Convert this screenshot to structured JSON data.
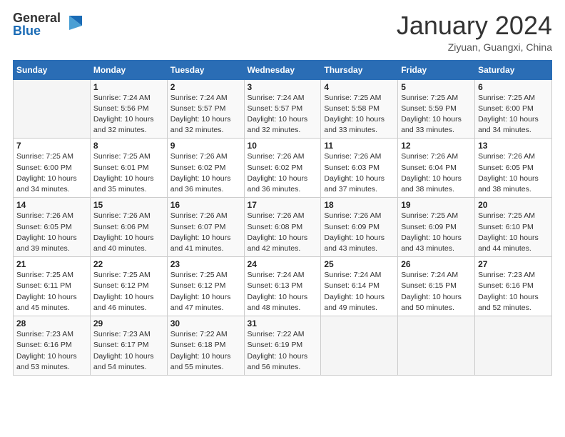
{
  "logo": {
    "general": "General",
    "blue": "Blue"
  },
  "header": {
    "month": "January 2024",
    "location": "Ziyuan, Guangxi, China"
  },
  "weekdays": [
    "Sunday",
    "Monday",
    "Tuesday",
    "Wednesday",
    "Thursday",
    "Friday",
    "Saturday"
  ],
  "weeks": [
    [
      {
        "day": "",
        "sunrise": "",
        "sunset": "",
        "daylight": ""
      },
      {
        "day": "1",
        "sunrise": "7:24 AM",
        "sunset": "5:56 PM",
        "daylight": "10 hours and 32 minutes."
      },
      {
        "day": "2",
        "sunrise": "7:24 AM",
        "sunset": "5:57 PM",
        "daylight": "10 hours and 32 minutes."
      },
      {
        "day": "3",
        "sunrise": "7:24 AM",
        "sunset": "5:57 PM",
        "daylight": "10 hours and 32 minutes."
      },
      {
        "day": "4",
        "sunrise": "7:25 AM",
        "sunset": "5:58 PM",
        "daylight": "10 hours and 33 minutes."
      },
      {
        "day": "5",
        "sunrise": "7:25 AM",
        "sunset": "5:59 PM",
        "daylight": "10 hours and 33 minutes."
      },
      {
        "day": "6",
        "sunrise": "7:25 AM",
        "sunset": "6:00 PM",
        "daylight": "10 hours and 34 minutes."
      }
    ],
    [
      {
        "day": "7",
        "sunrise": "7:25 AM",
        "sunset": "6:00 PM",
        "daylight": "10 hours and 34 minutes."
      },
      {
        "day": "8",
        "sunrise": "7:25 AM",
        "sunset": "6:01 PM",
        "daylight": "10 hours and 35 minutes."
      },
      {
        "day": "9",
        "sunrise": "7:26 AM",
        "sunset": "6:02 PM",
        "daylight": "10 hours and 36 minutes."
      },
      {
        "day": "10",
        "sunrise": "7:26 AM",
        "sunset": "6:02 PM",
        "daylight": "10 hours and 36 minutes."
      },
      {
        "day": "11",
        "sunrise": "7:26 AM",
        "sunset": "6:03 PM",
        "daylight": "10 hours and 37 minutes."
      },
      {
        "day": "12",
        "sunrise": "7:26 AM",
        "sunset": "6:04 PM",
        "daylight": "10 hours and 38 minutes."
      },
      {
        "day": "13",
        "sunrise": "7:26 AM",
        "sunset": "6:05 PM",
        "daylight": "10 hours and 38 minutes."
      }
    ],
    [
      {
        "day": "14",
        "sunrise": "7:26 AM",
        "sunset": "6:05 PM",
        "daylight": "10 hours and 39 minutes."
      },
      {
        "day": "15",
        "sunrise": "7:26 AM",
        "sunset": "6:06 PM",
        "daylight": "10 hours and 40 minutes."
      },
      {
        "day": "16",
        "sunrise": "7:26 AM",
        "sunset": "6:07 PM",
        "daylight": "10 hours and 41 minutes."
      },
      {
        "day": "17",
        "sunrise": "7:26 AM",
        "sunset": "6:08 PM",
        "daylight": "10 hours and 42 minutes."
      },
      {
        "day": "18",
        "sunrise": "7:26 AM",
        "sunset": "6:09 PM",
        "daylight": "10 hours and 43 minutes."
      },
      {
        "day": "19",
        "sunrise": "7:25 AM",
        "sunset": "6:09 PM",
        "daylight": "10 hours and 43 minutes."
      },
      {
        "day": "20",
        "sunrise": "7:25 AM",
        "sunset": "6:10 PM",
        "daylight": "10 hours and 44 minutes."
      }
    ],
    [
      {
        "day": "21",
        "sunrise": "7:25 AM",
        "sunset": "6:11 PM",
        "daylight": "10 hours and 45 minutes."
      },
      {
        "day": "22",
        "sunrise": "7:25 AM",
        "sunset": "6:12 PM",
        "daylight": "10 hours and 46 minutes."
      },
      {
        "day": "23",
        "sunrise": "7:25 AM",
        "sunset": "6:12 PM",
        "daylight": "10 hours and 47 minutes."
      },
      {
        "day": "24",
        "sunrise": "7:24 AM",
        "sunset": "6:13 PM",
        "daylight": "10 hours and 48 minutes."
      },
      {
        "day": "25",
        "sunrise": "7:24 AM",
        "sunset": "6:14 PM",
        "daylight": "10 hours and 49 minutes."
      },
      {
        "day": "26",
        "sunrise": "7:24 AM",
        "sunset": "6:15 PM",
        "daylight": "10 hours and 50 minutes."
      },
      {
        "day": "27",
        "sunrise": "7:23 AM",
        "sunset": "6:16 PM",
        "daylight": "10 hours and 52 minutes."
      }
    ],
    [
      {
        "day": "28",
        "sunrise": "7:23 AM",
        "sunset": "6:16 PM",
        "daylight": "10 hours and 53 minutes."
      },
      {
        "day": "29",
        "sunrise": "7:23 AM",
        "sunset": "6:17 PM",
        "daylight": "10 hours and 54 minutes."
      },
      {
        "day": "30",
        "sunrise": "7:22 AM",
        "sunset": "6:18 PM",
        "daylight": "10 hours and 55 minutes."
      },
      {
        "day": "31",
        "sunrise": "7:22 AM",
        "sunset": "6:19 PM",
        "daylight": "10 hours and 56 minutes."
      },
      {
        "day": "",
        "sunrise": "",
        "sunset": "",
        "daylight": ""
      },
      {
        "day": "",
        "sunrise": "",
        "sunset": "",
        "daylight": ""
      },
      {
        "day": "",
        "sunrise": "",
        "sunset": "",
        "daylight": ""
      }
    ]
  ]
}
